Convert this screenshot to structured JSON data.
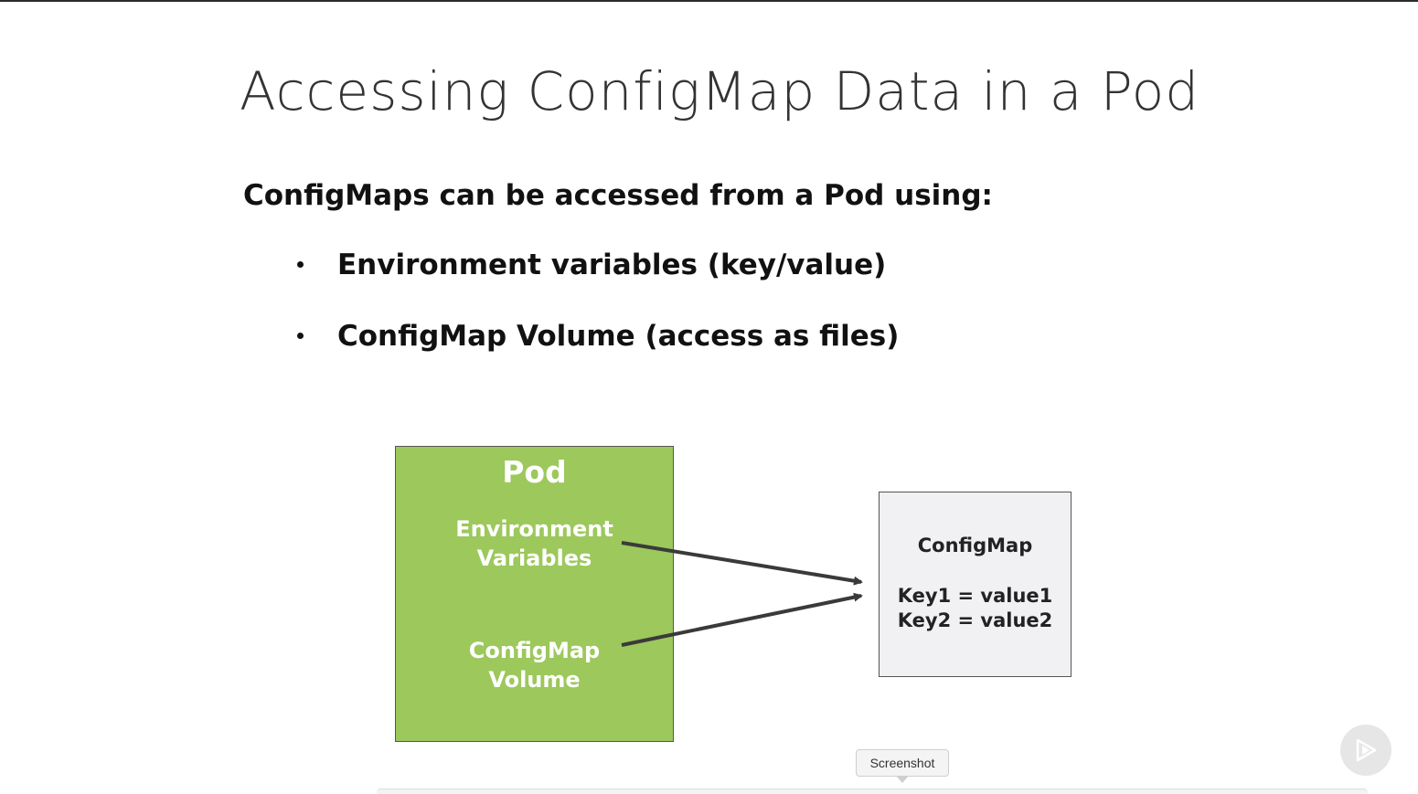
{
  "slide": {
    "title": "Accessing ConfigMap Data in a Pod",
    "intro": "ConfigMaps can be accessed from a Pod using:",
    "bullets": [
      "Environment variables (key/value)",
      "ConfigMap Volume (access as files)"
    ]
  },
  "diagram": {
    "pod": {
      "title": "Pod",
      "env_line1": "Environment",
      "env_line2": "Variables",
      "vol_line1": "ConfigMap",
      "vol_line2": "Volume"
    },
    "configmap": {
      "title": "ConfigMap",
      "key1": "Key1 = value1",
      "key2": "Key2 = value2"
    }
  },
  "tooltip": {
    "label": "Screenshot"
  },
  "player": {
    "icon": "play-icon"
  },
  "colors": {
    "pod_fill": "#9cc85c",
    "configmap_fill": "#f1f0f3",
    "arrow": "#3a3a3a"
  }
}
